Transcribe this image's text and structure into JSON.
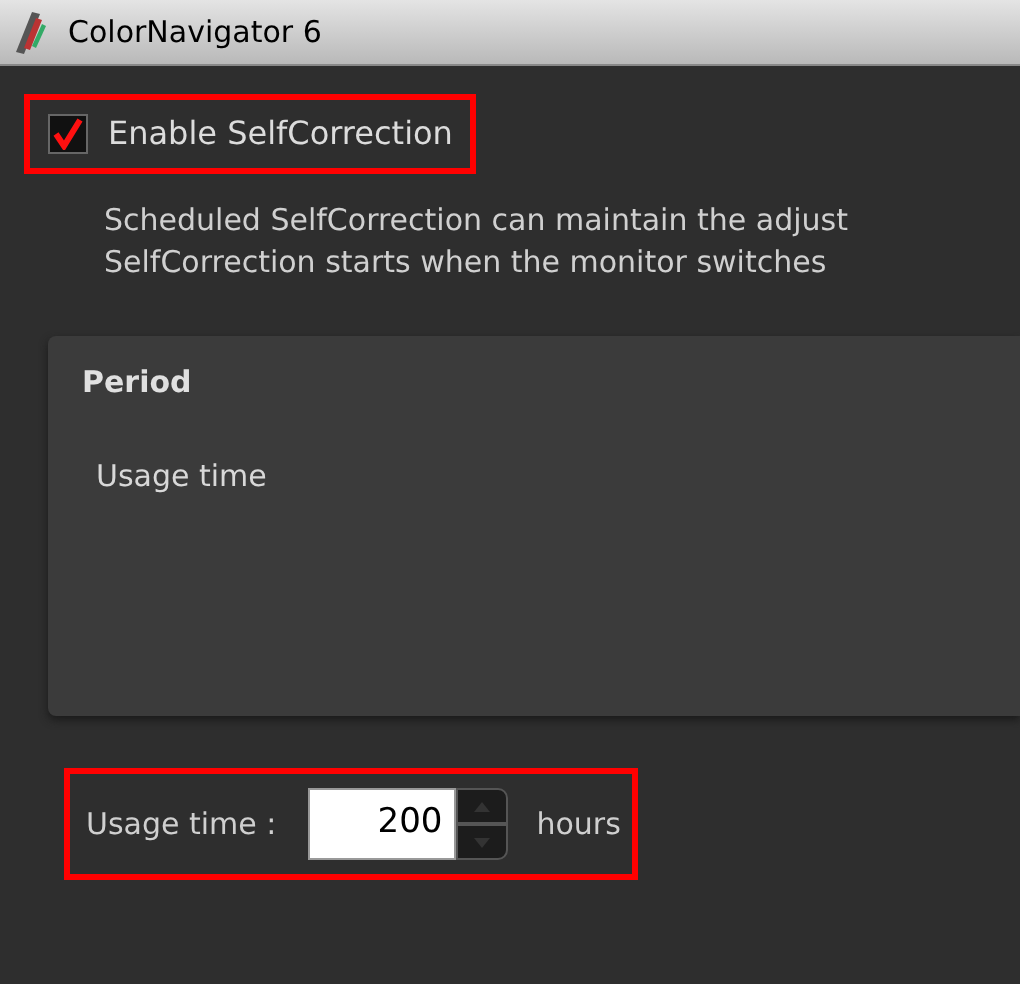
{
  "window": {
    "title": "ColorNavigator 6"
  },
  "enable": {
    "label": "Enable SelfCorrection",
    "checked": true
  },
  "description": [
    "Scheduled SelfCorrection can maintain the adjust",
    "SelfCorrection starts when the monitor switches"
  ],
  "period": {
    "title": "Period",
    "option": "Usage time"
  },
  "usage": {
    "label": "Usage time :",
    "value": "200",
    "unit": "hours"
  }
}
